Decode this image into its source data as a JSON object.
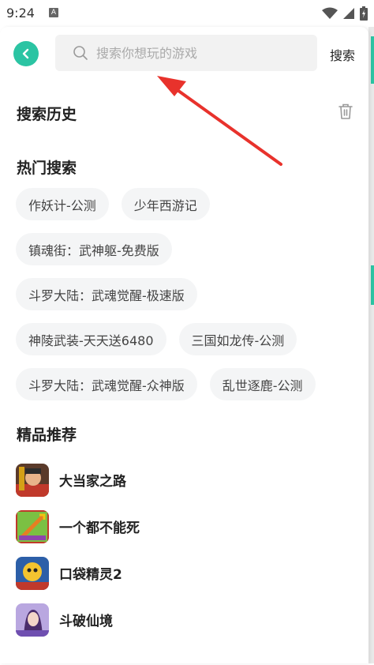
{
  "status_bar": {
    "time": "9:24",
    "notif_letter": "A"
  },
  "search": {
    "placeholder": "搜索你想玩的游戏",
    "value": "",
    "submit_label": "搜索"
  },
  "history": {
    "title": "搜索历史"
  },
  "hot": {
    "title": "热门搜索",
    "rows": [
      [
        "作妖计-公测",
        "少年西游记"
      ],
      [
        "镇魂街：武神躯-免费版"
      ],
      [
        "斗罗大陆：武魂觉醒-极速版"
      ],
      [
        "神陵武装-天天送6480",
        "三国如龙传-公测"
      ],
      [
        "斗罗大陆：武魂觉醒-众神版",
        "乱世逐鹿-公测"
      ]
    ]
  },
  "recommend": {
    "title": "精品推荐",
    "games": [
      {
        "name": "大当家之路"
      },
      {
        "name": "一个都不能死"
      },
      {
        "name": "口袋精灵2"
      },
      {
        "name": "斗破仙境"
      }
    ]
  },
  "colors": {
    "accent": "#2bc4a3",
    "annotation_arrow": "#e8322c"
  }
}
